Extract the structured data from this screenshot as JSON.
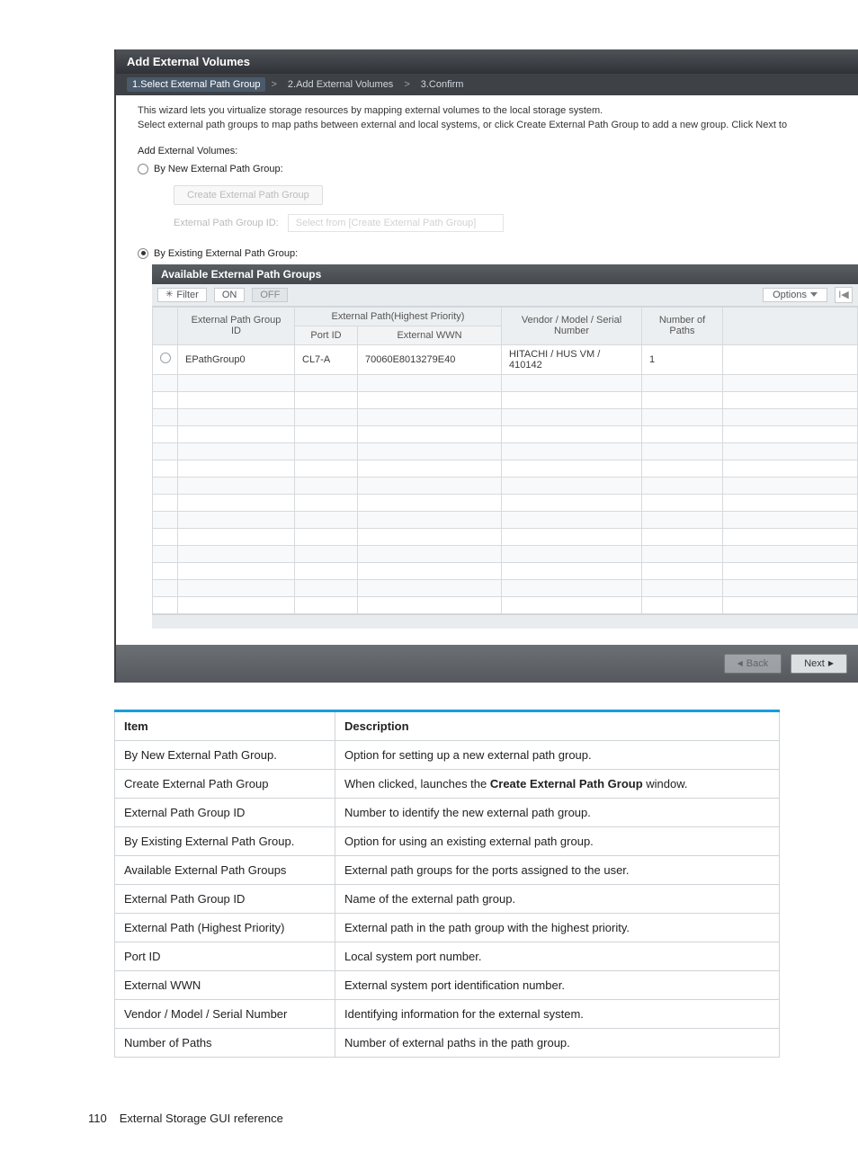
{
  "shot": {
    "title": "Add External Volumes",
    "wizard": {
      "step1": "1.Select External Path Group",
      "step2": "2.Add External Volumes",
      "step3": "3.Confirm",
      "sep": ">"
    },
    "intro_line1": "This wizard lets you virtualize storage resources by mapping external volumes to the local storage system.",
    "intro_line2": "Select external path groups to map paths between external and local systems, or click Create External Path Group to add a new group. Click Next to",
    "section_label": "Add External Volumes:",
    "radio_new": "By New External Path Group:",
    "create_btn": "Create External Path Group",
    "path_id_label": "External Path Group ID:",
    "path_id_placeholder": "Select from [Create External Path Group]",
    "radio_existing": "By Existing External Path Group:",
    "panel_title": "Available External Path Groups",
    "toolbar": {
      "filter": "Filter",
      "on": "ON",
      "off": "OFF",
      "options": "Options"
    },
    "columns": {
      "group_id": "External Path Group ID",
      "highest": "External Path(Highest Priority)",
      "port_id": "Port ID",
      "ext_wwn": "External WWN",
      "vendor": "Vendor / Model / Serial Number",
      "num_paths": "Number of Paths"
    },
    "row": {
      "group_id": "EPathGroup0",
      "port_id": "CL7-A",
      "ext_wwn": "70060E8013279E40",
      "vendor": "HITACHI / HUS VM / 410142",
      "num_paths": "1"
    },
    "buttons": {
      "back": "Back",
      "next": "Next"
    }
  },
  "desc": {
    "head_item": "Item",
    "head_desc": "Description",
    "rows": [
      {
        "item": "By New External Path Group.",
        "desc": "Option for setting up a new external path group."
      },
      {
        "item": "Create External Path Group",
        "desc_pre": "When clicked, launches the ",
        "desc_bold": "Create External Path Group",
        "desc_post": " window."
      },
      {
        "item": "External Path Group ID",
        "desc": "Number to identify the new external path group."
      },
      {
        "item": "By Existing External Path Group.",
        "desc": "Option for using an existing external path group."
      },
      {
        "item": "Available External Path Groups",
        "desc": "External path groups for the ports assigned to the user."
      },
      {
        "item": "External Path Group ID",
        "desc": "Name of the external path group."
      },
      {
        "item": "External Path (Highest Priority)",
        "desc": "External path in the path group with the highest priority."
      },
      {
        "item": "Port ID",
        "desc": "Local system port number."
      },
      {
        "item": "External WWN",
        "desc": "External system port identification number."
      },
      {
        "item": "Vendor / Model / Serial Number",
        "desc": "Identifying information for the external system."
      },
      {
        "item": "Number of Paths",
        "desc": "Number of external paths in the path group."
      }
    ]
  },
  "footer": {
    "page": "110",
    "text": "External Storage GUI reference"
  }
}
